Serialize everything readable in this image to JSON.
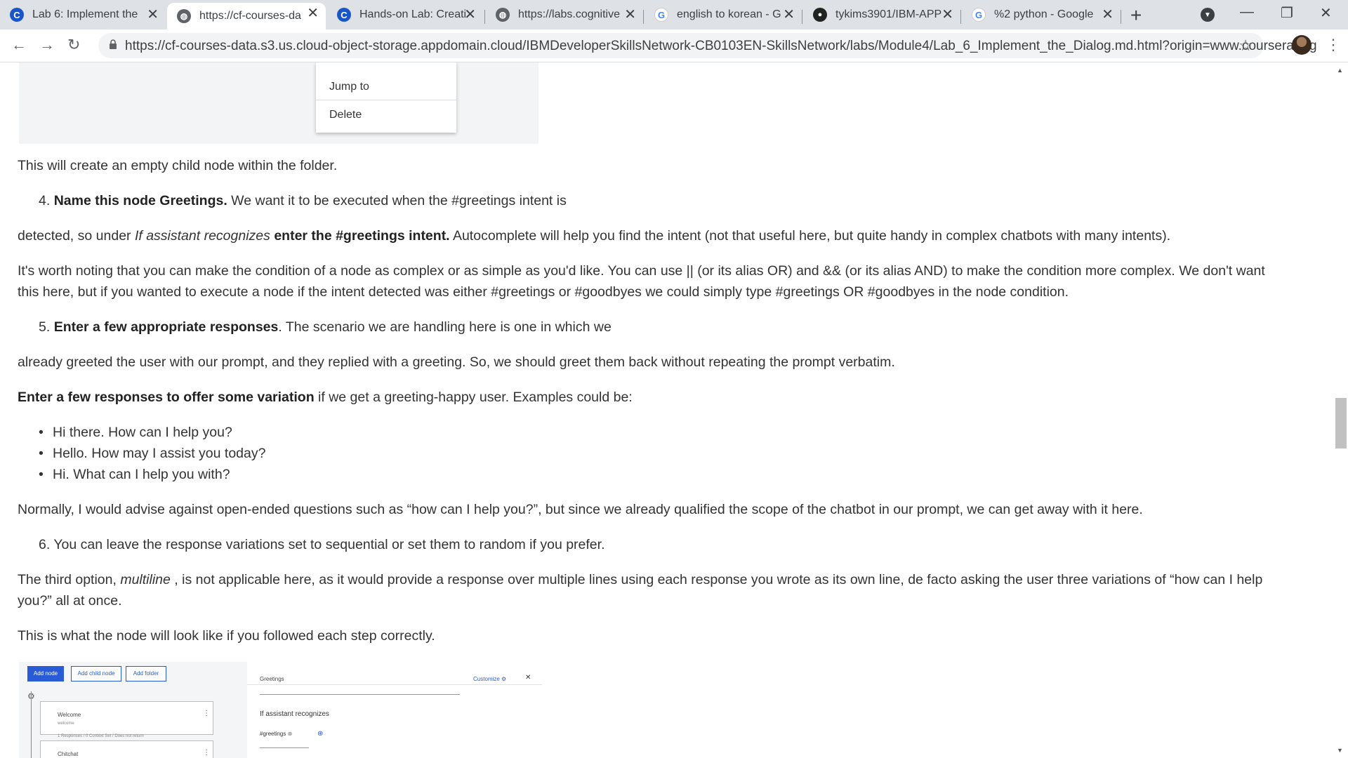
{
  "browser": {
    "tabs": [
      {
        "title": "Lab 6: Implement the",
        "favicon": "coursera-icon"
      },
      {
        "title": "https://cf-courses-da",
        "favicon": "globe-icon",
        "active": true
      },
      {
        "title": "Hands-on Lab: Creati",
        "favicon": "coursera-icon"
      },
      {
        "title": "https://labs.cognitive",
        "favicon": "globe-icon"
      },
      {
        "title": "english to korean - G",
        "favicon": "google-icon"
      },
      {
        "title": "tykims3901/IBM-APP",
        "favicon": "github-icon"
      },
      {
        "title": "%2 python - Google",
        "favicon": "google-icon"
      }
    ],
    "url": "https://cf-courses-data.s3.us.cloud-object-storage.appdomain.cloud/IBMDeveloperSkillsNetwork-CB0103EN-SkillsNetwork/labs/Module4/Lab_6_Implement_the_Dialog.md.html?origin=www.coursera.org"
  },
  "top_image": {
    "menu_items": [
      "Jump to",
      "Delete"
    ]
  },
  "content": {
    "p1": "This will create an empty child node within the folder.",
    "step4_num": "4.",
    "step4_bold": "Name this node Greetings.",
    "step4_rest": " We want it to be executed when the #greetings intent is",
    "p2_a": "detected, so under ",
    "p2_em": "If assistant recognizes",
    "p2_b": " ",
    "p2_bold": "enter the #greetings intent.",
    "p2_c": " Autocomplete will help you find the intent (not that useful here, but quite handy in complex chatbots with many intents).",
    "p3_line1": "It's worth noting that you can make the condition of a node as complex or as simple as you'd like. You can use || (or its alias OR) and && (or its alias AND) to make the condition more complex. We don't want",
    "p3_line2": "this here, but if you wanted to execute a node if the intent detected was either #greetings or #goodbyes we could simply type #greetings OR #goodbyes in the node condition.",
    "step5_num": "5.",
    "step5_bold": "Enter a few appropriate responses",
    "step5_rest": ". The scenario we are handling here is one in which we",
    "p4": "already greeted the user with our prompt, and they replied with a greeting. So, we should greet them back without repeating the prompt verbatim.",
    "p5_bold": "Enter a few responses to offer some variation",
    "p5_rest": " if we get a greeting-happy user. Examples could be:",
    "bullets": [
      "Hi there. How can I help you?",
      "Hello. How may I assist you today?",
      "Hi. What can I help you with?"
    ],
    "p6": "Normally, I would advise against open-ended questions such as “how can I help you?”, but since we already qualified the scope of the chatbot in our prompt, we can get away with it here.",
    "step6": "6. You can leave the response variations set to sequential or set them to random if you prefer.",
    "p7_a": "The third option, ",
    "p7_em": "multiline",
    "p7_b": " , is not applicable here, as it would provide a response over multiple lines using each response you wrote as its own line, de facto asking the user three variations of “how can I help",
    "p7_line2": "you?” all at once.",
    "p8": "This is what the node will look like if you followed each step correctly."
  },
  "bottom_image": {
    "buttons": [
      "Add node",
      "Add child node",
      "Add folder"
    ],
    "node1_title": "Welcome",
    "node1_sub": "welcome",
    "node1_meta": "1 Responses / 0 Context Set / Does not return",
    "node2_title": "Chitchat",
    "node_name": "Greetings",
    "customize": "Customize",
    "if_label": "If assistant recognizes",
    "condition": "#greetings"
  }
}
